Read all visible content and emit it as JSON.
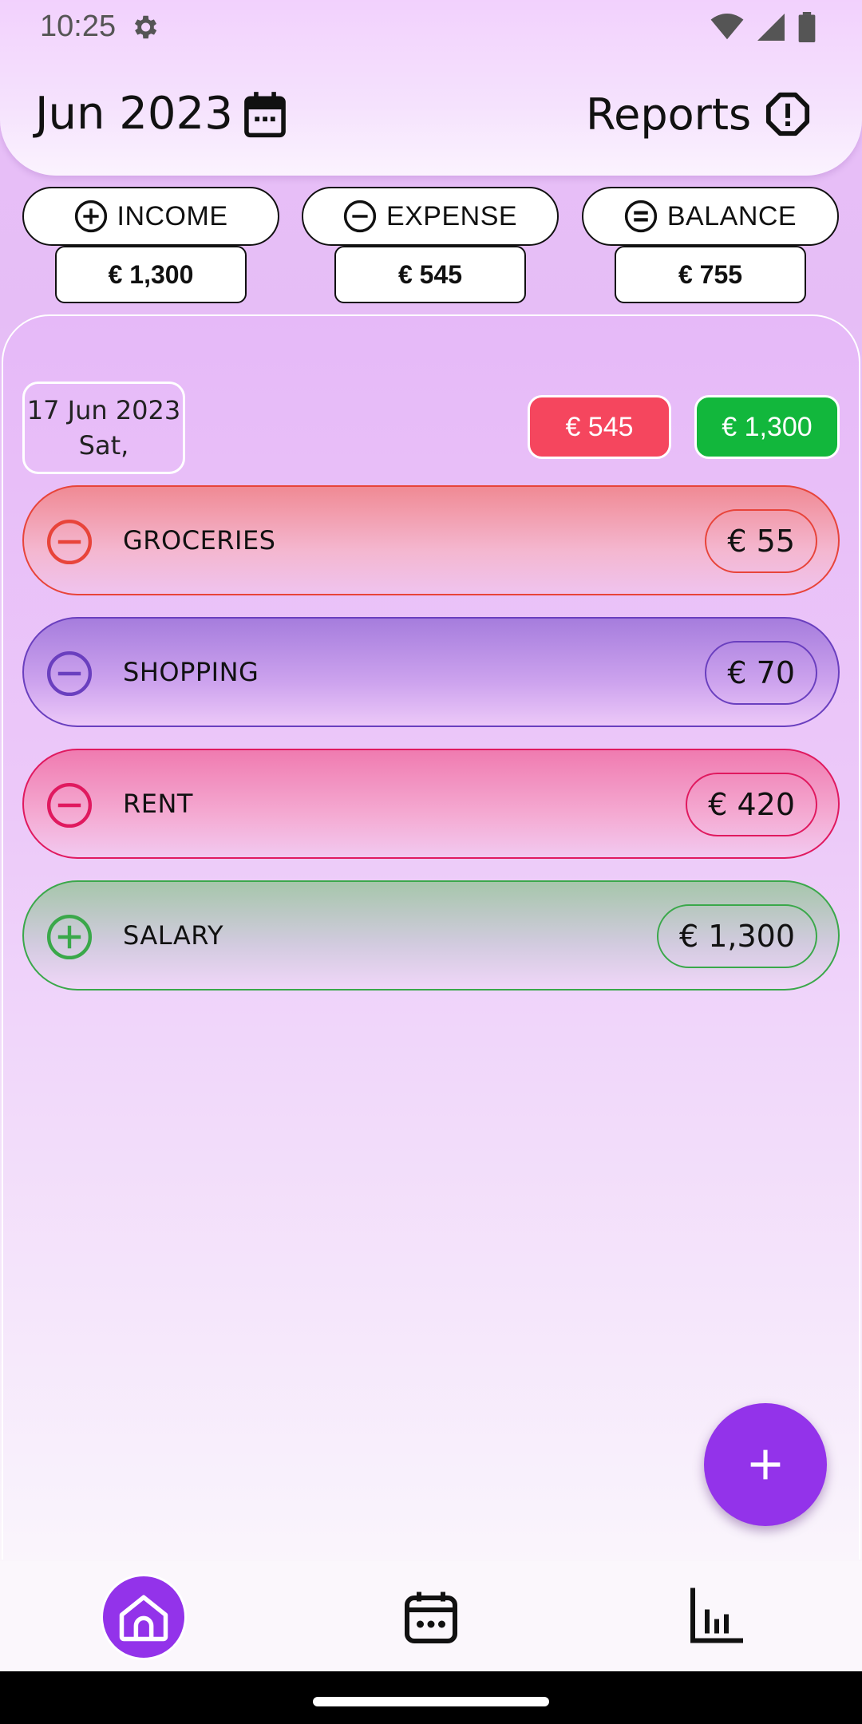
{
  "status_bar": {
    "time": "10:25"
  },
  "header": {
    "month": "Jun 2023",
    "reports_label": "Reports"
  },
  "summary": {
    "income_label": "INCOME",
    "expense_label": "EXPENSE",
    "balance_label": "BALANCE",
    "income_amount": "€ 1,300",
    "expense_amount": "€ 545",
    "balance_amount": "€ 755"
  },
  "day": {
    "date": "17 Jun 2023",
    "weekday": "Sat,",
    "expense_total": "€ 545",
    "income_total": "€ 1,300"
  },
  "entries": [
    {
      "label": "GROCERIES",
      "amount": "€ 55",
      "type": "expense",
      "color": "#e8443a"
    },
    {
      "label": "SHOPPING",
      "amount": "€ 70",
      "type": "expense",
      "color": "#6a3fbf"
    },
    {
      "label": "RENT",
      "amount": "€ 420",
      "type": "expense",
      "color": "#e0195f"
    },
    {
      "label": "SALARY",
      "amount": "€ 1,300",
      "type": "income",
      "color": "#3aa84a"
    }
  ],
  "colors": {
    "accent": "#9333ea",
    "expense_badge": "#f5465e",
    "income_badge": "#12b73c"
  },
  "icons": {
    "status": [
      "gear-icon",
      "wifi-icon",
      "signal-icon",
      "battery-icon"
    ],
    "header": [
      "calendar-icon",
      "alert-octagon-icon"
    ],
    "summary": [
      "plus-circle-icon",
      "minus-circle-icon",
      "equals-circle-icon"
    ],
    "nav": [
      "home-icon",
      "calendar-dots-icon",
      "bar-chart-icon"
    ],
    "fab": "plus-icon"
  }
}
